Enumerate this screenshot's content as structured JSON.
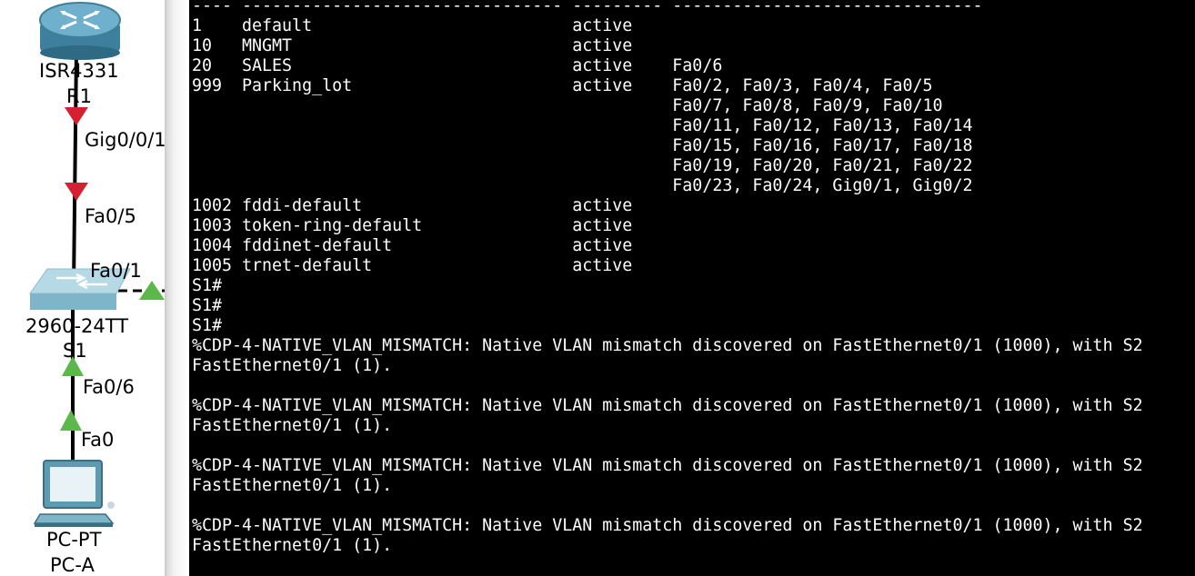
{
  "topology": {
    "router": {
      "model": "ISR4331",
      "name": "R1"
    },
    "link_router_switch": {
      "router_port": "Gig0/0/1",
      "switch_port": "Fa0/5"
    },
    "trunk_port": "Fa0/1",
    "switch": {
      "model": "2960-24TT",
      "name": "S1"
    },
    "link_switch_pc": {
      "switch_port": "Fa0/6",
      "pc_port": "Fa0"
    },
    "pc": {
      "model": "PC-PT",
      "name": "PC-A"
    },
    "colors": {
      "link_down": "#d62032",
      "link_up": "#5cb84a",
      "cable": "#000000"
    },
    "icons": [
      "router-icon",
      "switch-icon",
      "pc-icon",
      "link-down-triangle",
      "link-up-triangle"
    ]
  },
  "terminal": {
    "lines": [
      "---- -------------------------------- --------- -------------------------------",
      "1    default                          active",
      "10   MNGMT                            active",
      "20   SALES                            active    Fa0/6",
      "999  Parking_lot                      active    Fa0/2, Fa0/3, Fa0/4, Fa0/5",
      "                                                Fa0/7, Fa0/8, Fa0/9, Fa0/10",
      "                                                Fa0/11, Fa0/12, Fa0/13, Fa0/14",
      "                                                Fa0/15, Fa0/16, Fa0/17, Fa0/18",
      "                                                Fa0/19, Fa0/20, Fa0/21, Fa0/22",
      "                                                Fa0/23, Fa0/24, Gig0/1, Gig0/2",
      "1002 fddi-default                     active",
      "1003 token-ring-default               active",
      "1004 fddinet-default                  active",
      "1005 trnet-default                    active",
      "S1#",
      "S1#",
      "S1#",
      "%CDP-4-NATIVE_VLAN_MISMATCH: Native VLAN mismatch discovered on FastEthernet0/1 (1000), with S2",
      "FastEthernet0/1 (1).",
      "",
      "%CDP-4-NATIVE_VLAN_MISMATCH: Native VLAN mismatch discovered on FastEthernet0/1 (1000), with S2",
      "FastEthernet0/1 (1).",
      "",
      "%CDP-4-NATIVE_VLAN_MISMATCH: Native VLAN mismatch discovered on FastEthernet0/1 (1000), with S2",
      "FastEthernet0/1 (1).",
      "",
      "%CDP-4-NATIVE_VLAN_MISMATCH: Native VLAN mismatch discovered on FastEthernet0/1 (1000), with S2",
      "FastEthernet0/1 (1)."
    ]
  }
}
